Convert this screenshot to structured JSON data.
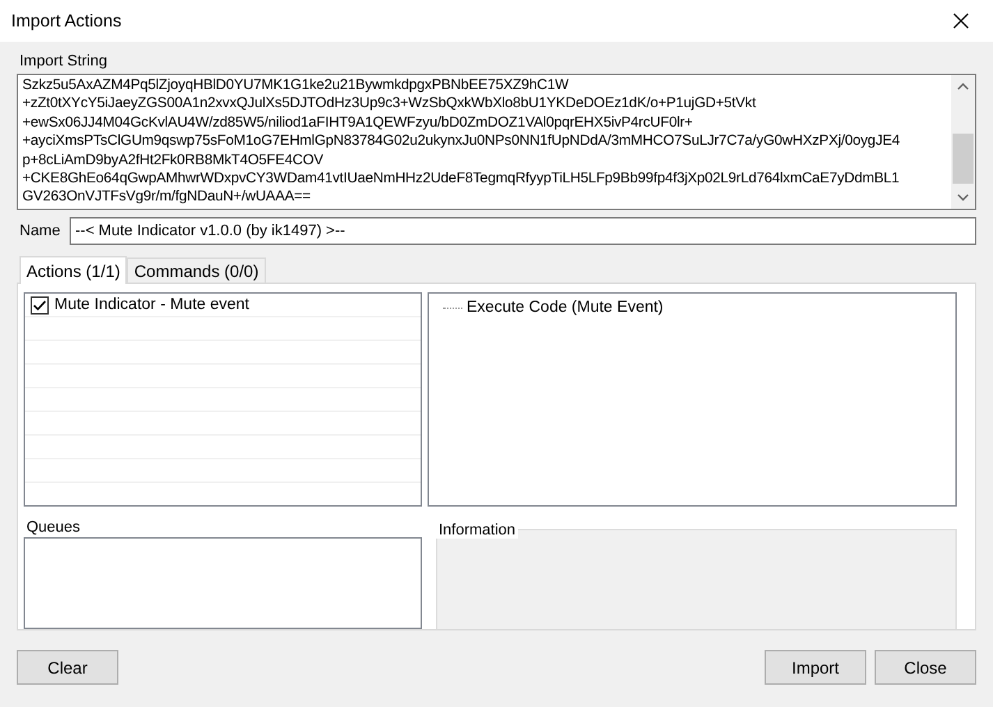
{
  "window": {
    "title": "Import Actions"
  },
  "import_string": {
    "label": "Import String",
    "lines": [
      "Szkz5u5AxAZM4Pq5lZjoyqHBlD0YU7MK1G1ke2u21BywmkdpgxPBNbEE75XZ9hC1W",
      "+zZt0tXYcY5iJaeyZGS00A1n2xvxQJulXs5DJTOdHz3Up9c3+WzSbQxkWbXlo8bU1YKDeDOEz1dK/o+P1ujGD+5tVkt",
      "+ewSx06JJ4M04GcKvlAU4W/zd85W5/niliod1aFIHT9A1QEWFzyu/bD0ZmDOZ1VAl0pqrEHX5ivP4rcUF0lr+",
      "+ayciXmsPTsClGUm9qswp75sFoM1oG7EHmlGpN83784G02u2ukynxJu0NPs0NN1fUpNDdA/3mMHCO7SuLJr7C7a/yG0wHXzPXj/0oygJE4",
      "p+8cLiAmD9byA2fHt2Fk0RB8MkT4O5FE4COV",
      "+CKE8GhEo64qGwpAMhwrWDxpvCY3WDam41vtIUaeNmHHz2UdeF8TegmqRfyypTiLH5LFp9Bb99fp4f3jXp02L9rLd764lxmCaE7yDdmBL1",
      "GV263OnVJTFsVg9r/m/fgNDauN+/wUAAA=="
    ]
  },
  "name_field": {
    "label": "Name",
    "value": "--< Mute Indicator v1.0.0 (by ik1497) >--"
  },
  "tabs": [
    {
      "label": "Actions (1/1)",
      "selected": true
    },
    {
      "label": "Commands (0/0)",
      "selected": false
    }
  ],
  "actions": [
    {
      "label": "Mute Indicator - Mute event",
      "checked": true
    }
  ],
  "sub_actions": [
    {
      "label": "Execute Code (Mute Event)"
    }
  ],
  "queues": {
    "label": "Queues"
  },
  "information": {
    "label": "Information"
  },
  "left_buttons": [
    "Clear"
  ],
  "right_buttons": [
    "Import",
    "Close"
  ]
}
